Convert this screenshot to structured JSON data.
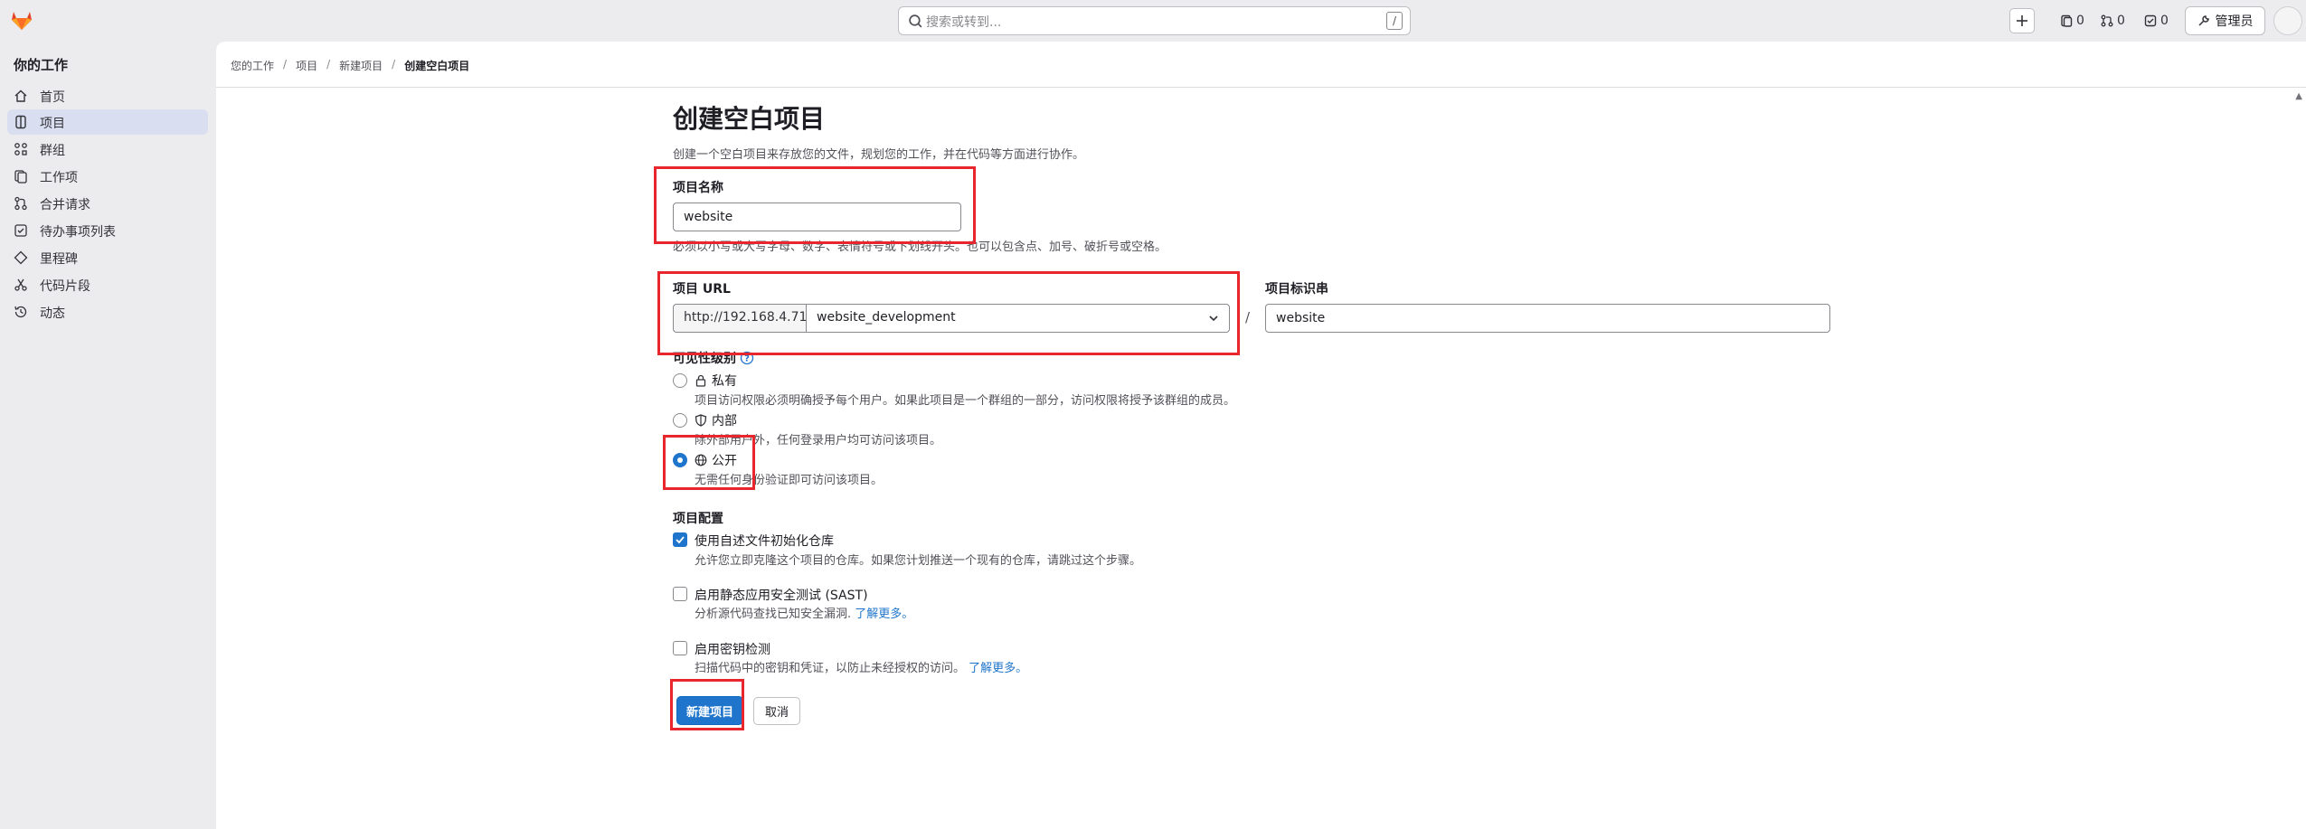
{
  "topbar": {
    "search_placeholder": "搜索或转到...",
    "search_shortcut": "/",
    "issues_count": "0",
    "mr_count": "0",
    "todo_count": "0",
    "admin_label": "管理员"
  },
  "sidebar": {
    "title": "你的工作",
    "items": [
      {
        "label": "首页",
        "icon": "home-icon"
      },
      {
        "label": "项目",
        "icon": "project-icon",
        "active": true
      },
      {
        "label": "群组",
        "icon": "group-icon"
      },
      {
        "label": "工作项",
        "icon": "work-item-icon"
      },
      {
        "label": "合并请求",
        "icon": "merge-request-icon"
      },
      {
        "label": "待办事项列表",
        "icon": "todo-icon"
      },
      {
        "label": "里程碑",
        "icon": "milestone-icon"
      },
      {
        "label": "代码片段",
        "icon": "snippet-icon"
      },
      {
        "label": "动态",
        "icon": "history-icon"
      }
    ]
  },
  "breadcrumb": [
    "您的工作",
    "项目",
    "新建项目",
    "创建空白项目"
  ],
  "form": {
    "title": "创建空白项目",
    "description": "创建一个空白项目来存放您的文件，规划您的工作，并在代码等方面进行协作。",
    "name_label": "项目名称",
    "name_value": "website",
    "name_help": "必须以小写或大写字母、数字、表情符号或下划线开头。也可以包含点、加号、破折号或空格。",
    "url_label": "项目 URL",
    "url_prefix": "http://192.168.4.71/",
    "url_namespace": "website_development",
    "url_separator": "/",
    "slug_label": "项目标识串",
    "slug_value": "website",
    "visibility_label": "可见性级别",
    "visibility": [
      {
        "label": "私有",
        "icon": "lock-icon",
        "desc": "项目访问权限必须明确授予每个用户。如果此项目是一个群组的一部分，访问权限将授予该群组的成员。",
        "selected": false
      },
      {
        "label": "内部",
        "icon": "shield-icon",
        "desc": "除外部用户外，任何登录用户均可访问该项目。",
        "selected": false
      },
      {
        "label": "公开",
        "icon": "globe-icon",
        "desc": "无需任何身份验证即可访问该项目。",
        "selected": true
      }
    ],
    "config_label": "项目配置",
    "configs": [
      {
        "label": "使用自述文件初始化仓库",
        "desc": "允许您立即克隆这个项目的仓库。如果您计划推送一个现有的仓库，请跳过这个步骤。",
        "link": "",
        "checked": true
      },
      {
        "label": "启用静态应用安全测试 (SAST)",
        "desc": "分析源代码查找已知安全漏洞.",
        "link": "了解更多。",
        "checked": false
      },
      {
        "label": "启用密钥检测",
        "desc": "扫描代码中的密钥和凭证，以防止未经授权的访问。",
        "link": "了解更多。",
        "checked": false
      }
    ],
    "submit_label": "新建项目",
    "cancel_label": "取消"
  },
  "colors": {
    "primary": "#1f75cb",
    "highlight": "#e8262e",
    "logo": "#e24329"
  }
}
